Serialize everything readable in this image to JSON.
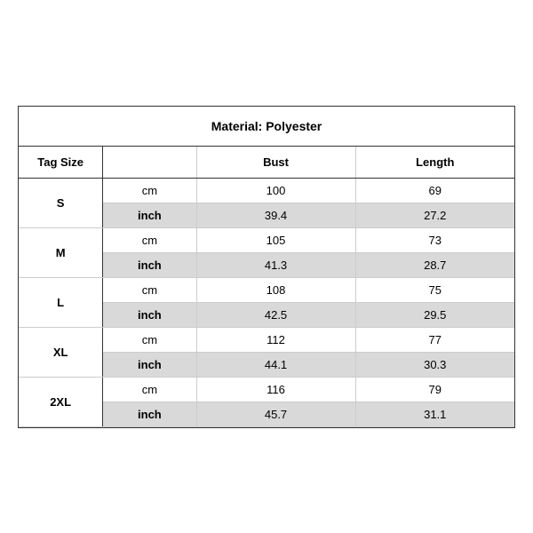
{
  "title": "Material: Polyester",
  "header": {
    "tag_size": "Tag Size",
    "bust": "Bust",
    "length": "Length"
  },
  "sizes": [
    {
      "tag": "S",
      "rows": [
        {
          "unit": "cm",
          "bust": "100",
          "length": "69",
          "shaded": false
        },
        {
          "unit": "inch",
          "bust": "39.4",
          "length": "27.2",
          "shaded": true
        }
      ]
    },
    {
      "tag": "M",
      "rows": [
        {
          "unit": "cm",
          "bust": "105",
          "length": "73",
          "shaded": false
        },
        {
          "unit": "inch",
          "bust": "41.3",
          "length": "28.7",
          "shaded": true
        }
      ]
    },
    {
      "tag": "L",
      "rows": [
        {
          "unit": "cm",
          "bust": "108",
          "length": "75",
          "shaded": false
        },
        {
          "unit": "inch",
          "bust": "42.5",
          "length": "29.5",
          "shaded": true
        }
      ]
    },
    {
      "tag": "XL",
      "rows": [
        {
          "unit": "cm",
          "bust": "112",
          "length": "77",
          "shaded": false
        },
        {
          "unit": "inch",
          "bust": "44.1",
          "length": "30.3",
          "shaded": true
        }
      ]
    },
    {
      "tag": "2XL",
      "rows": [
        {
          "unit": "cm",
          "bust": "116",
          "length": "79",
          "shaded": false
        },
        {
          "unit": "inch",
          "bust": "45.7",
          "length": "31.1",
          "shaded": true
        }
      ]
    }
  ]
}
